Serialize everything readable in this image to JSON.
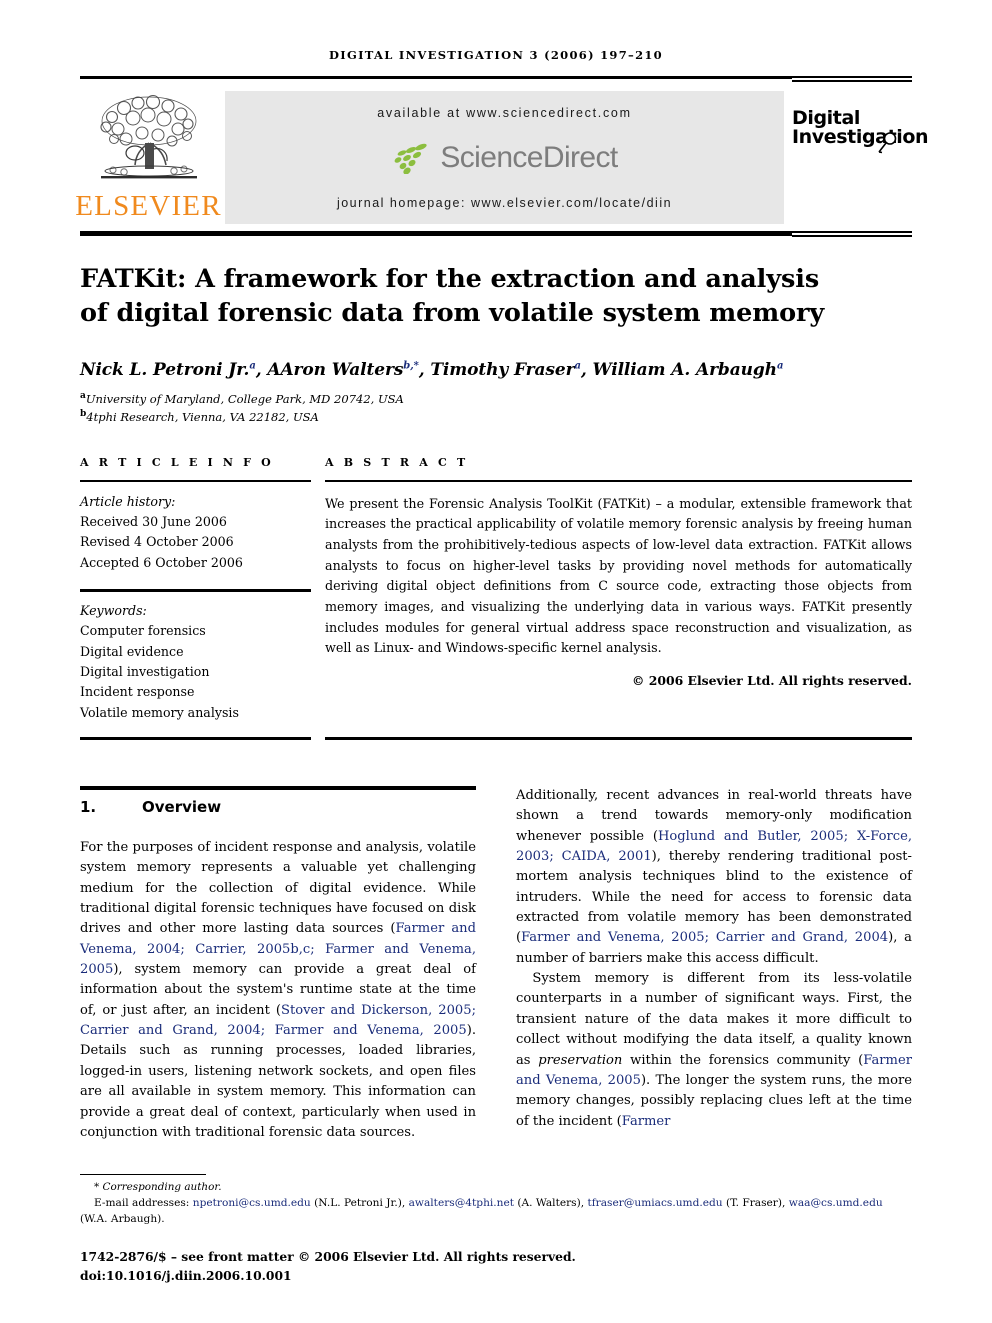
{
  "running_head": "DIGITAL INVESTIGATION 3 (2006) 197–210",
  "masthead": {
    "publisher_wordmark": "ELSEVIER",
    "publisher_logo_icon": "elsevier-tree-icon",
    "available_at": "available at www.sciencedirect.com",
    "sciencedirect_wordmark": "ScienceDirect",
    "sciencedirect_logo_icon": "sciencedirect-leaf-dots-icon",
    "journal_homepage": "journal homepage: www.elsevier.com/locate/diin",
    "journal_name_line1": "Digital",
    "journal_name_line2": "Investigation",
    "journal_loupe_icon": "magnifying-glass-icon",
    "brand_orange": "#F08A1E",
    "sciencedirect_gray": "#7d7d7d",
    "sciencedirect_green": "#8CBE3F",
    "panel_gray": "#e7e7e7"
  },
  "article": {
    "title_line1": "FATKit: A framework for the extraction and analysis",
    "title_line2": "of digital forensic data from volatile system memory",
    "authors": [
      {
        "name": "Nick L. Petroni Jr.",
        "marks": "a",
        "sep": ", "
      },
      {
        "name": "AAron Walters",
        "marks": "b,*",
        "sep": ", "
      },
      {
        "name": "Timothy Fraser",
        "marks": "a",
        "sep": ", "
      },
      {
        "name": "William A. Arbaugh",
        "marks": "a",
        "sep": ""
      }
    ],
    "affiliations": [
      {
        "mark": "a",
        "text": "University of Maryland, College Park, MD 20742, USA"
      },
      {
        "mark": "b",
        "text": "4tphi Research, Vienna, VA 22182, USA"
      }
    ]
  },
  "article_info": {
    "heading": "A R T I C L E  I N F O",
    "history_label": "Article history:",
    "history": [
      "Received 30 June 2006",
      "Revised 4 October 2006",
      "Accepted 6 October 2006"
    ],
    "keywords_label": "Keywords:",
    "keywords": [
      "Computer forensics",
      "Digital evidence",
      "Digital investigation",
      "Incident response",
      "Volatile memory analysis"
    ]
  },
  "abstract": {
    "heading": "A B S T R A C T",
    "text": "We present the Forensic Analysis ToolKit (FATKit) – a modular, extensible framework that increases the practical applicability of volatile memory forensic analysis by freeing human analysts from the prohibitively-tedious aspects of low-level data extraction. FATKit allows analysts to focus on higher-level tasks by providing novel methods for automatically deriving digital object definitions from C source code, extracting those objects from memory images, and visualizing the underlying data in various ways. FATKit presently includes modules for general virtual address space reconstruction and visualization, as well as Linux- and Windows-specific kernel analysis.",
    "copyright": "© 2006 Elsevier Ltd. All rights reserved."
  },
  "section": {
    "number": "1.",
    "title": "Overview"
  },
  "body": {
    "left_column": [
      {
        "segments": [
          {
            "t": "For the purposes of incident response and analysis, volatile system memory represents a valuable yet challenging medium for the collection of digital evidence. While traditional digital forensic techniques have focused on disk drives and other more lasting data sources (",
            "k": "text"
          },
          {
            "t": "Farmer and Venema, 2004; Carrier, 2005b,c; Farmer and Venema, 2005",
            "k": "cite"
          },
          {
            "t": "), system memory can provide a great deal of information about the system's runtime state at the time of, or just after, an incident (",
            "k": "text"
          },
          {
            "t": "Stover and Dickerson, 2005; Carrier and Grand, 2004; Farmer and Venema, 2005",
            "k": "cite"
          },
          {
            "t": "). Details such as running processes, loaded libraries, logged-in users, listening network sockets, and open files are all available in system memory. This information can provide a great deal of context, particularly when used in conjunction with traditional forensic data sources.",
            "k": "text"
          }
        ]
      }
    ],
    "right_column": [
      {
        "segments": [
          {
            "t": "Additionally, recent advances in real-world threats have shown a trend towards memory-only modification whenever possible (",
            "k": "text"
          },
          {
            "t": "Hoglund and Butler, 2005; X-Force, 2003; CAIDA, 2001",
            "k": "cite"
          },
          {
            "t": "), thereby rendering traditional post-mortem analysis techniques blind to the existence of intruders. While the need for access to forensic data extracted from volatile memory has been demonstrated (",
            "k": "text"
          },
          {
            "t": "Farmer and Venema, 2005; Carrier and Grand, 2004",
            "k": "cite"
          },
          {
            "t": "), a number of barriers make this access difficult.",
            "k": "text"
          }
        ]
      },
      {
        "indent": true,
        "segments": [
          {
            "t": "System memory is different from its less-volatile counterparts in a number of significant ways. First, the transient nature of the data makes it more difficult to collect without modifying the data itself, a quality known as ",
            "k": "text"
          },
          {
            "t": "preservation",
            "k": "em"
          },
          {
            "t": " within the forensics community (",
            "k": "text"
          },
          {
            "t": "Farmer and Venema, 2005",
            "k": "cite"
          },
          {
            "t": "). The longer the system runs, the more memory changes, possibly replacing clues left at the time of the incident (",
            "k": "text"
          },
          {
            "t": "Farmer",
            "k": "cite"
          }
        ]
      }
    ]
  },
  "footnote": {
    "corresponding_star": "*",
    "corresponding_text": "Corresponding author.",
    "emails_label": "E-mail addresses:",
    "emails": [
      {
        "address": "npetroni@cs.umd.edu",
        "owner": "(N.L. Petroni Jr.)",
        "sep": ", "
      },
      {
        "address": "awalters@4tphi.net",
        "owner": "(A. Walters)",
        "sep": ", "
      },
      {
        "address": "tfraser@umiacs.umd.edu",
        "owner": "(T. Fraser)",
        "sep": ", "
      },
      {
        "address": "waa@cs.umd.edu",
        "owner": "(W.A. Arbaugh).",
        "sep": ""
      }
    ]
  },
  "imprint": {
    "issn_line": "1742-2876/$ – see front matter © 2006 Elsevier Ltd. All rights reserved.",
    "doi_line": "doi:10.1016/j.diin.2006.10.001"
  }
}
